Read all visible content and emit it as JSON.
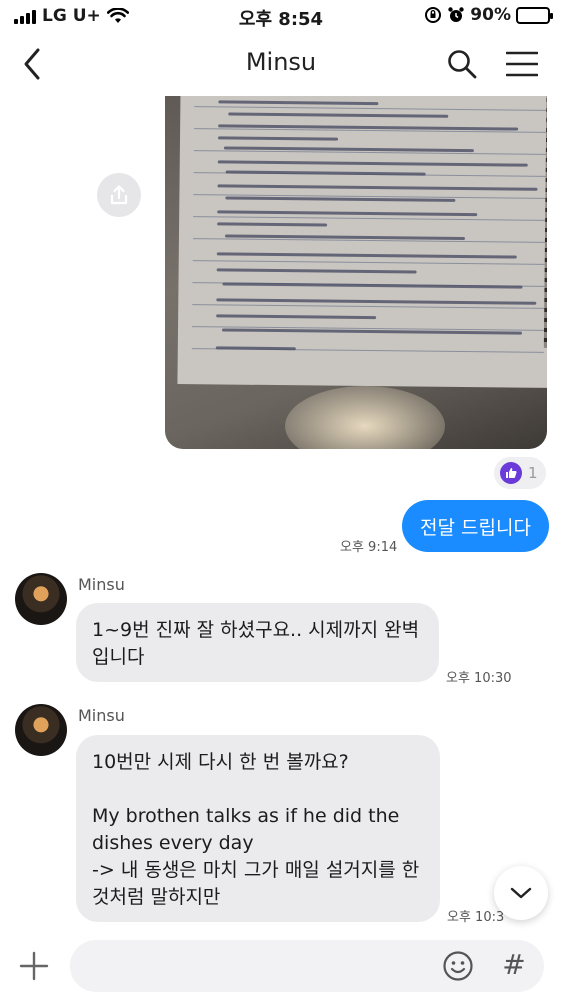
{
  "status_bar": {
    "carrier": "LG U+",
    "time": "오후 8:54",
    "battery": "90%"
  },
  "header": {
    "title": "Minsu"
  },
  "messages": {
    "outgoing": {
      "reaction_count": "1",
      "text": "전달 드립니다",
      "time": "오후 9:14"
    },
    "incoming": [
      {
        "sender": "Minsu",
        "text": "1~9번 진짜 잘 하셨구요.. 시제까지 완벽\n입니다",
        "time": "오후 10:30"
      },
      {
        "sender": "Minsu",
        "text": "10번만 시제 다시 한 번 볼까요?\n\nMy brothen talks as if he did the\ndishes every day\n-> 내 동생은 마치 그가 매일 설거지를 한\n것처럼 말하지만",
        "time": "오후 10:3"
      }
    ]
  },
  "composer": {
    "placeholder": "",
    "hash": "#"
  },
  "icons": [
    "back-arrow-icon",
    "search-icon",
    "menu-icon",
    "share-icon",
    "like-icon",
    "chevron-down-icon",
    "plus-icon",
    "emoji-icon"
  ]
}
